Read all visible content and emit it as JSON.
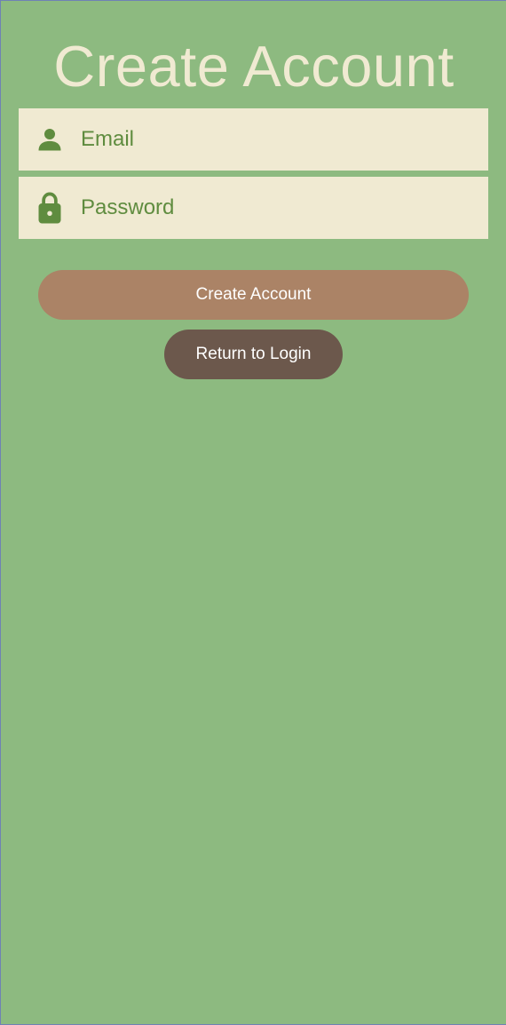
{
  "header": {
    "title": "Create Account"
  },
  "form": {
    "email": {
      "icon": "person-icon",
      "placeholder": "Email"
    },
    "password": {
      "icon": "lock-icon",
      "placeholder": "Password"
    }
  },
  "actions": {
    "create_label": "Create Account",
    "return_label": "Return to Login"
  },
  "colors": {
    "background": "#8dba80",
    "field_background": "#f0ead2",
    "title_text": "#f0ead2",
    "field_text": "#5f8c3f",
    "primary_button": "#ab8366",
    "secondary_button": "#6c584c"
  }
}
